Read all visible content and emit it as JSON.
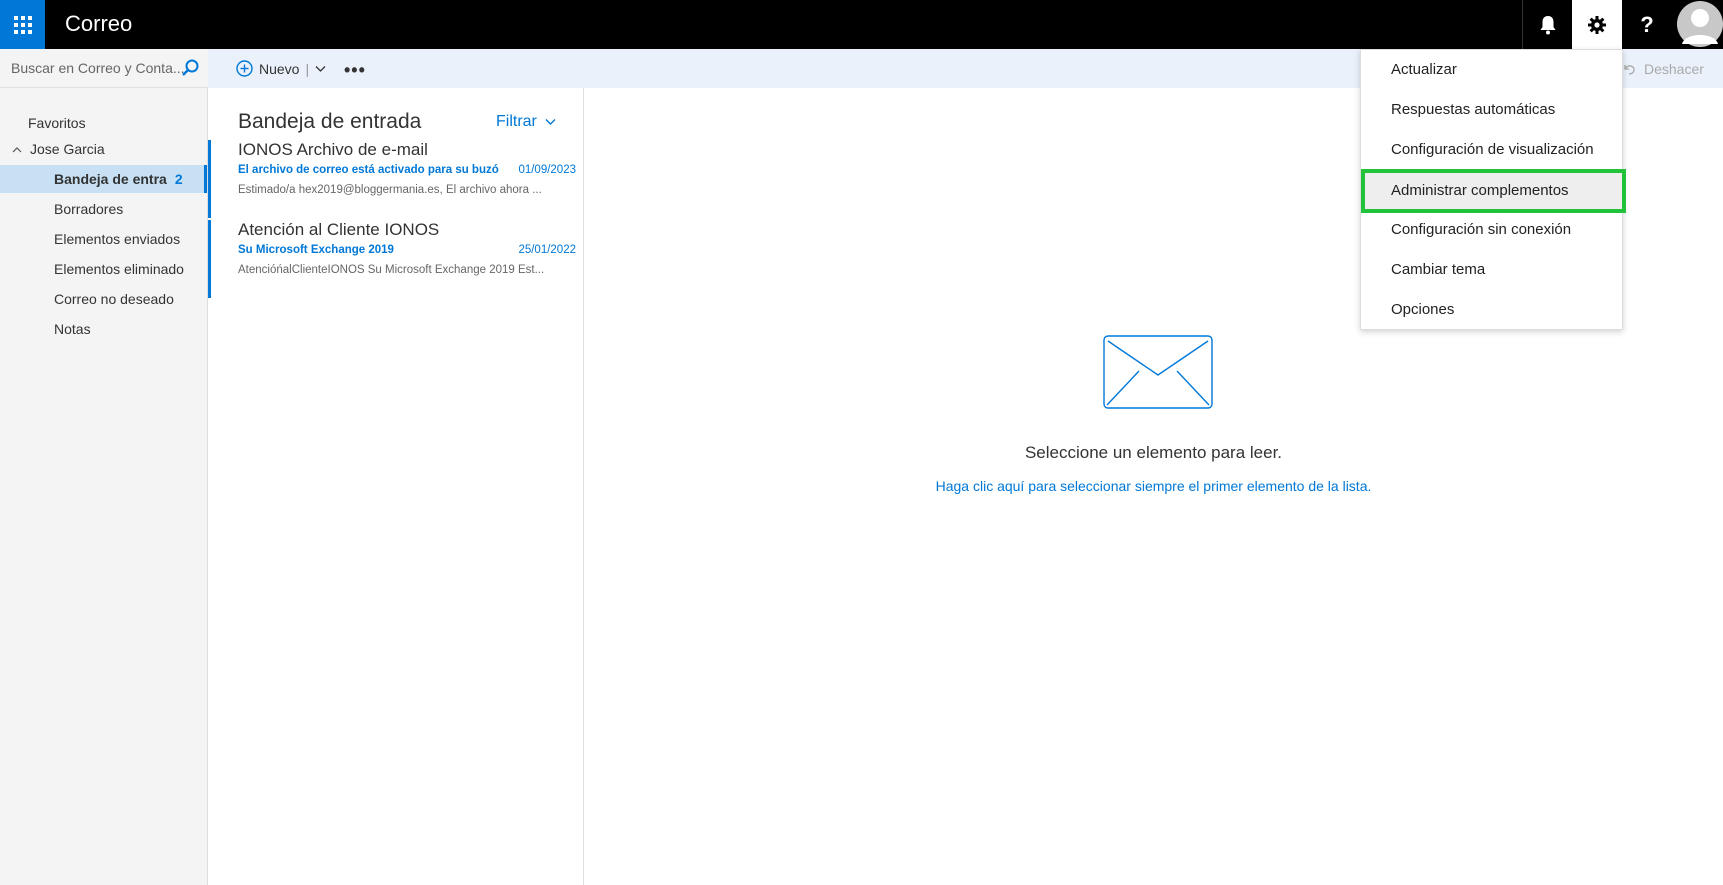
{
  "topbar": {
    "app_title": "Correo",
    "icons": [
      "waffle-icon",
      "bell-icon",
      "gear-icon",
      "help-icon",
      "avatar"
    ],
    "help_label": "?"
  },
  "commandbar": {
    "search_placeholder": "Buscar en Correo y Conta...",
    "new_label": "Nuevo",
    "new_separator": "|",
    "more_label": "•••",
    "undo_label": "Deshacer"
  },
  "sidebar": {
    "favorites_label": "Favoritos",
    "account_name": "Jose Garcia",
    "items": [
      {
        "label": "Bandeja de entra",
        "count": "2",
        "active": true
      },
      {
        "label": "Borradores"
      },
      {
        "label": "Elementos enviados"
      },
      {
        "label": "Elementos eliminado"
      },
      {
        "label": "Correo no deseado"
      },
      {
        "label": "Notas"
      }
    ]
  },
  "message_list": {
    "title": "Bandeja de entrada",
    "filter_label": "Filtrar",
    "messages": [
      {
        "from": "IONOS Archivo de e-mail",
        "subject": "El archivo de correo está activado para su buzó",
        "date": "01/09/2023",
        "preview": "Estimado/a hex2019@bloggermania.es, El archivo ahora ..."
      },
      {
        "from": "Atención al Cliente IONOS",
        "subject": "Su Microsoft Exchange 2019",
        "date": "25/01/2022",
        "preview": "AtencióńalClienteIONOS Su Microsoft Exchange 2019 Est..."
      }
    ]
  },
  "reading_pane": {
    "empty_text": "Seleccione un elemento para leer.",
    "link_text": "Haga clic aquí para seleccionar siempre el primer elemento de la lista."
  },
  "settings_menu": {
    "items": [
      {
        "label": "Actualizar"
      },
      {
        "label": "Respuestas automáticas"
      },
      {
        "label": "Configuración de visualización"
      },
      {
        "label": "Administrar complementos",
        "highlighted": true
      },
      {
        "label": "Configuración sin conexión"
      },
      {
        "label": "Cambiar tema"
      },
      {
        "label": "Opciones"
      }
    ]
  },
  "colors": {
    "accent": "#0078d7",
    "highlight_border": "#22c33a",
    "topbar": "#000000"
  }
}
